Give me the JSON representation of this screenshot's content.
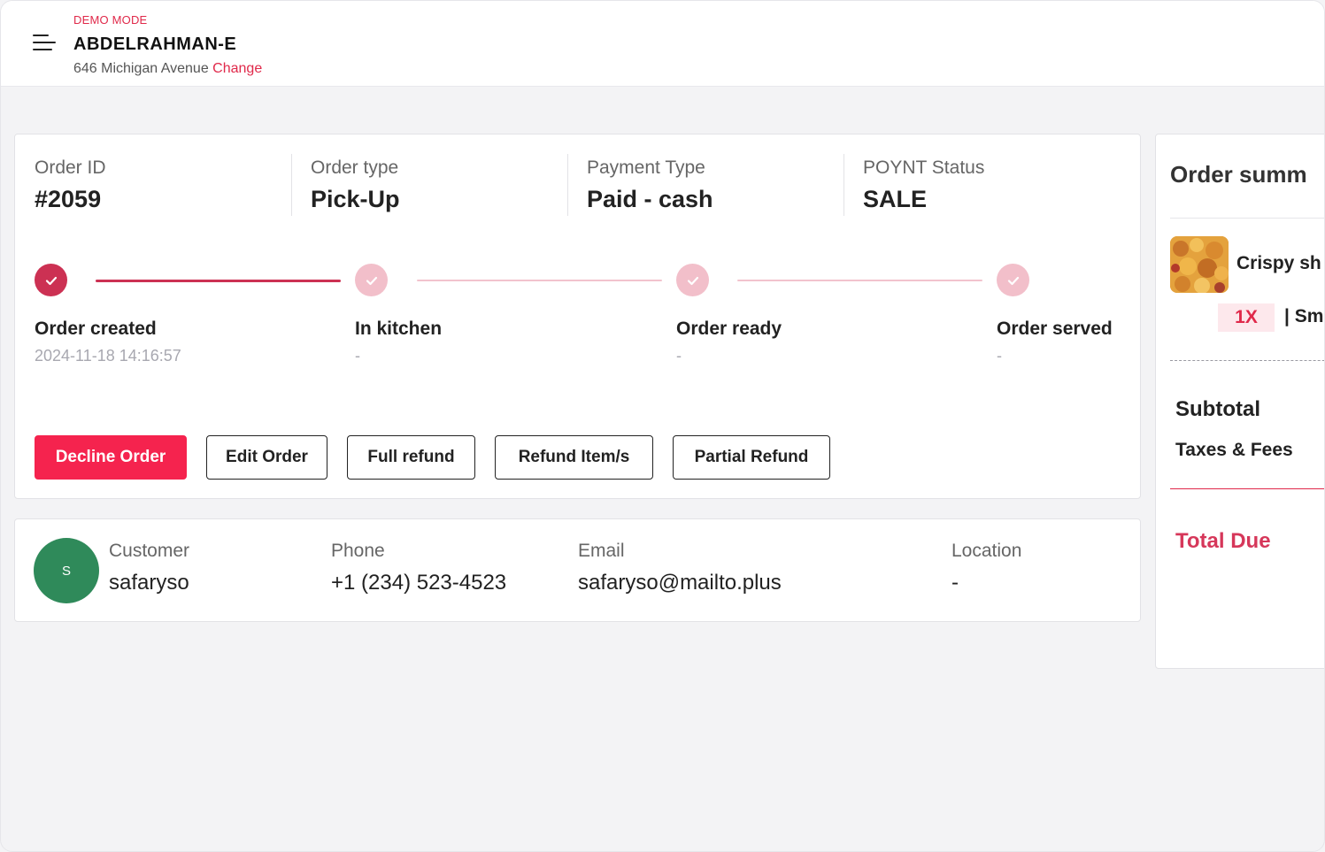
{
  "header": {
    "mode": "DEMO MODE",
    "store_name": "ABDELRAHMAN-E",
    "address": "646 Michigan Avenue",
    "change_label": "Change"
  },
  "order": {
    "info": [
      {
        "label": "Order ID",
        "value": "#2059"
      },
      {
        "label": "Order type",
        "value": "Pick-Up"
      },
      {
        "label": "Payment Type",
        "value": "Paid - cash"
      },
      {
        "label": "POYNT Status",
        "value": "SALE"
      }
    ],
    "steps": [
      {
        "name": "Order created",
        "time": "2024-11-18 14:16:57",
        "status": "done"
      },
      {
        "name": "In kitchen",
        "time": "-",
        "status": "pending"
      },
      {
        "name": "Order ready",
        "time": "-",
        "status": "pending"
      },
      {
        "name": "Order served",
        "time": "-",
        "status": "pending"
      }
    ],
    "actions": {
      "decline": "Decline Order",
      "edit": "Edit Order",
      "full_refund": "Full refund",
      "refund_items": "Refund Item/s",
      "partial_refund": "Partial Refund"
    }
  },
  "customer": {
    "avatar_initial": "S",
    "name_label": "Customer",
    "name": "safaryso",
    "phone_label": "Phone",
    "phone": "+1 (234) 523-4523",
    "email_label": "Email",
    "email": "safaryso@mailto.plus",
    "location_label": "Location",
    "location": "-"
  },
  "summary": {
    "title": "Order summ",
    "item_name": "Crispy sh",
    "item_qty": "1X",
    "item_size": "| Sm",
    "subtotal_label": "Subtotal",
    "taxes_label": "Taxes & Fees",
    "total_label": "Total Due"
  },
  "colors": {
    "accent": "#e0294a",
    "step_done": "#cc3153",
    "step_todo": "#f2bfca",
    "avatar": "#2f8a5a",
    "decline_button": "#f5234e"
  }
}
